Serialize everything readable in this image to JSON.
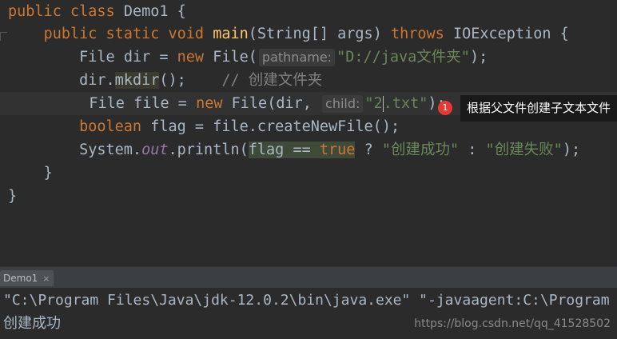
{
  "editor": {
    "line1": {
      "k1": "public",
      "k2": "class",
      "name": "Demo1",
      "brace": "{"
    },
    "line2": {
      "k1": "public",
      "k2": "static",
      "k3": "void",
      "method": "main",
      "params": "(String[] args)",
      "throws": "throws",
      "exc": "IOException",
      "brace": "{"
    },
    "line3": {
      "type": "File",
      "var": "dir",
      "eq": "=",
      "new": "new",
      "ctor": "File(",
      "hint": "pathname:",
      "arg": "\"D://java文件夹\"",
      "end": ");"
    },
    "line4": {
      "obj": "dir.",
      "call": "mkdir",
      "rest": "();",
      "comment": "// 创建文件夹"
    },
    "line5": {
      "type": "File",
      "var": "file",
      "eq": "=",
      "new": "new",
      "ctor": "File(dir,",
      "hint": "child:",
      "arg_a": "\"2",
      "arg_b": ".txt\"",
      "end": ");"
    },
    "line6": {
      "type": "boolean",
      "var": "flag",
      "eq": "=",
      "expr": "file.createNewFile();"
    },
    "line7": {
      "pre": "System.",
      "field": "out",
      "mid": ".println(",
      "cond_a": "flag ==",
      "cond_true": "true",
      "q": "?",
      "s1": "\"创建成功\"",
      "colon": ":",
      "s2": "\"创建失败\"",
      "end": ");"
    },
    "line8": {
      "brace": "}"
    },
    "line9": {
      "brace": "}"
    }
  },
  "annotation": {
    "badge": "1",
    "tooltip": "根据父文件创建子文本文件"
  },
  "run_panel": {
    "tab_label": "Demo1",
    "tab_close": "×"
  },
  "console": {
    "command": "\"C:\\Program Files\\Java\\jdk-12.0.2\\bin\\java.exe\" \"-javaagent:C:\\Program",
    "output": "创建成功"
  },
  "watermark": "https://blog.csdn.net/qq_41528502",
  "colors": {
    "keyword": "#cc7832",
    "method": "#ffc66d",
    "string": "#6a8759",
    "comment": "#808080",
    "background": "#2b2b2b"
  }
}
